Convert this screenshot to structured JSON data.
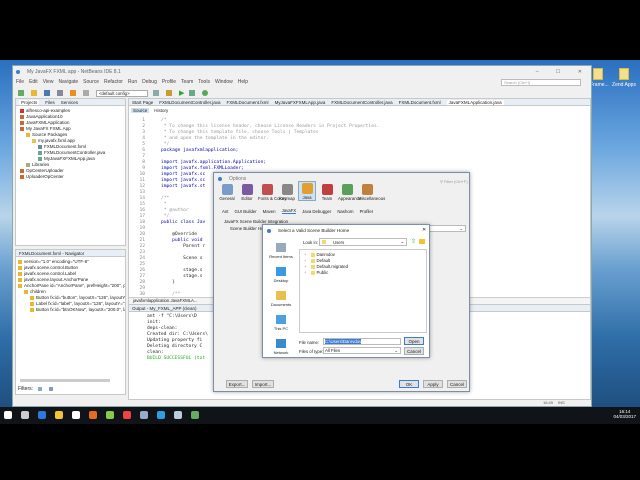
{
  "desktop": {
    "icons": [
      "dFrame...",
      "Zend Apps"
    ]
  },
  "window": {
    "title": "My JavaFX FXML app - NetBeans IDE 8.1",
    "menu": [
      "File",
      "Edit",
      "View",
      "Navigate",
      "Source",
      "Refactor",
      "Run",
      "Debug",
      "Profile",
      "Team",
      "Tools",
      "Window",
      "Help"
    ],
    "config": "<default config>",
    "search_placeholder": "Search (Ctrl+I)"
  },
  "projects": {
    "tabs": [
      "Projects",
      "Files",
      "Services"
    ],
    "items": [
      "alfresco-api-examples",
      "JavaApplication10",
      "JavaFXMLApplication",
      "My JavaFX FXML App",
      "Source Packages",
      "my.javafx.fxml.app",
      "FXMLDocument.fxml",
      "FXMLDocumentController.java",
      "MyJavaFXFXMLApp.java",
      "Libraries",
      "OpCenterUploader",
      "UploaderOpCenter"
    ]
  },
  "navigator": {
    "title": "FXMLDocument.fxml - Navigator",
    "items": [
      "version=\"1.0\" encoding=\"UTF-8\"",
      "javafx.scene.control.Button",
      "javafx.scene.control.Label",
      "javafx.scene.layout.AnchorPane",
      "AnchorPane id=\"AnchorPane\", prefHeight=\"200\", prefWidth=\"320\", xmlns:fx=\"ht",
      "children",
      "Button fx:id=\"button\", layoutX=\"126\", layoutY=\"90\", onAction=\"#hand",
      "Label fx:id=\"label\", layoutX=\"126\", layoutY=\"120\", minHeight=\"16\", minW",
      "Button fx:id=\"btnOKNow\", layoutX=\"200.0\", layoutY=\"34.0\", onAction"
    ],
    "filters_label": "Filters:"
  },
  "editor": {
    "tabs": [
      "Start Page",
      "FXMLDocumentController.java",
      "FXMLDocument.fxml",
      "MyJavaFXFXMLApp.java",
      "FXMLDocumentController.java",
      "FXMLDocument.fxml",
      "JavaFXMLApplication.java"
    ],
    "source_tab": "Source",
    "history_tab": "History",
    "lines": [
      {
        "n": "1",
        "t": "/*"
      },
      {
        "n": "2",
        "t": " * To change this license header, choose License Headers in Project Properties."
      },
      {
        "n": "3",
        "t": " * To change this template file, choose Tools | Templates"
      },
      {
        "n": "4",
        "t": " * and open the template in the editor."
      },
      {
        "n": "5",
        "t": " */"
      },
      {
        "n": "6",
        "t": "package javafxmlapplication;"
      },
      {
        "n": "7",
        "t": ""
      },
      {
        "n": "8",
        "t": "import javafx.application.Application;"
      },
      {
        "n": "9",
        "t": "import javafx.fxml.FXMLLoader;"
      },
      {
        "n": "10",
        "t": "import javafx.sc"
      },
      {
        "n": "11",
        "t": "import javafx.sc"
      },
      {
        "n": "12",
        "t": "import javafx.st"
      },
      {
        "n": "13",
        "t": ""
      },
      {
        "n": "14",
        "t": "/**"
      },
      {
        "n": "15",
        "t": " *"
      },
      {
        "n": "16",
        "t": " * @author"
      },
      {
        "n": "17",
        "t": " */"
      },
      {
        "n": "18",
        "t": "public class Jav"
      },
      {
        "n": "19",
        "t": ""
      },
      {
        "n": "20",
        "t": "    @Override"
      },
      {
        "n": "21",
        "t": "    public void"
      },
      {
        "n": "22",
        "t": "        Parent r"
      },
      {
        "n": "23",
        "t": ""
      },
      {
        "n": "24",
        "t": "        Scene s"
      },
      {
        "n": "25",
        "t": ""
      },
      {
        "n": "26",
        "t": "        stage.s"
      },
      {
        "n": "27",
        "t": "        stage.s"
      },
      {
        "n": "28",
        "t": "    }"
      },
      {
        "n": "29",
        "t": ""
      },
      {
        "n": "30",
        "t": "    /**"
      }
    ],
    "breadcrumb": "javafxmlapplication.JavaFXMLA..."
  },
  "output": {
    "title": "Output - My_FXML_APP (clean)",
    "lines": [
      "ant -f \"C:\\Users\\D",
      "init:",
      "deps-clean:",
      "Created dir: C:\\Users\\",
      "Updating property fi",
      "Deleting directory C",
      "clean:",
      "BUILD SUCCESSFUL (tot"
    ]
  },
  "status": {
    "position": "16:49",
    "mode": "INS"
  },
  "options": {
    "title": "Options",
    "filter_placeholder": "Filter (Ctrl+F)",
    "categories": [
      "General",
      "Editor",
      "Fonts & Colors",
      "Keymap",
      "Java",
      "Team",
      "Appearance",
      "Miscellaneous"
    ],
    "selected_category": "Java",
    "subtabs": [
      "Ant",
      "GUI Builder",
      "Maven",
      "JavaFX",
      "Java Debugger",
      "Nashorn",
      "Profiler"
    ],
    "selected_subtab": "JavaFX",
    "section": "JavaFX Scene Builder Integration",
    "home_label": "Scene Builder Home:",
    "export": "Export...",
    "import": "Import...",
    "ok": "OK",
    "apply": "Apply",
    "cancel": "Cancel"
  },
  "chooser": {
    "title": "Select a Valid Scene Builder Home",
    "look_in_label": "Look in:",
    "look_in": "Users",
    "places": [
      "Recent Items",
      "Desktop",
      "Documents",
      "This PC",
      "Network"
    ],
    "files": [
      "Danrvdov",
      "Default",
      "Default.migrated",
      "Public"
    ],
    "file_name_label": "File name:",
    "file_name": "C:\\Users\\Danrvdov",
    "type_label": "Files of type:",
    "type": "All Files",
    "open": "Open",
    "cancel": "Cancel"
  },
  "taskbar": {
    "time": "16:14",
    "date": "04/03/2017"
  }
}
